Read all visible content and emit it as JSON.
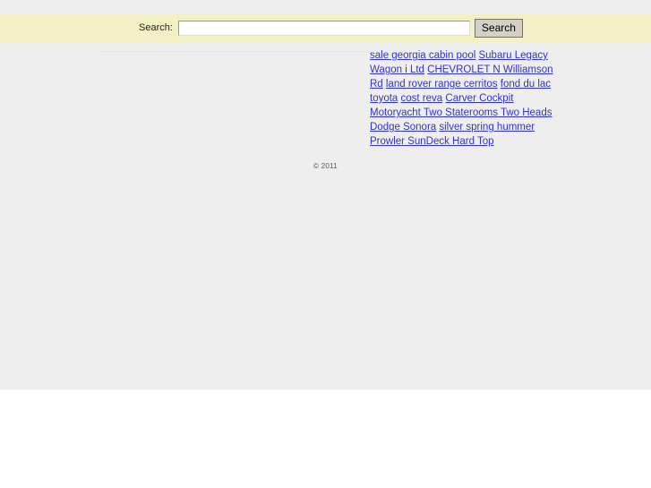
{
  "page": {
    "background_color": "#eeeeee",
    "outer_background_color": "#ffffff"
  },
  "search": {
    "label": "Search:",
    "input_value": "",
    "placeholder": "",
    "button_label": "Search",
    "band_color": "#f2f0c4"
  },
  "link_cloud": {
    "link_color": "#3333cc",
    "links": [
      {
        "text": "sale georgia cabin pool"
      },
      {
        "text": "Subaru Legacy Wagon i Ltd"
      },
      {
        "text": "CHEVROLET N Williamson Rd"
      },
      {
        "text": "land rover range cerritos"
      },
      {
        "text": "fond du lac toyota"
      },
      {
        "text": "cost reva"
      },
      {
        "text": "Carver Cockpit Motoryacht Two Staterooms Two Heads"
      },
      {
        "text": "Dodge Sonora"
      },
      {
        "text": "silver spring hummer"
      },
      {
        "text": "Prowler SunDeck Hard Top"
      }
    ]
  },
  "footer": {
    "copyright": "© 2011"
  }
}
